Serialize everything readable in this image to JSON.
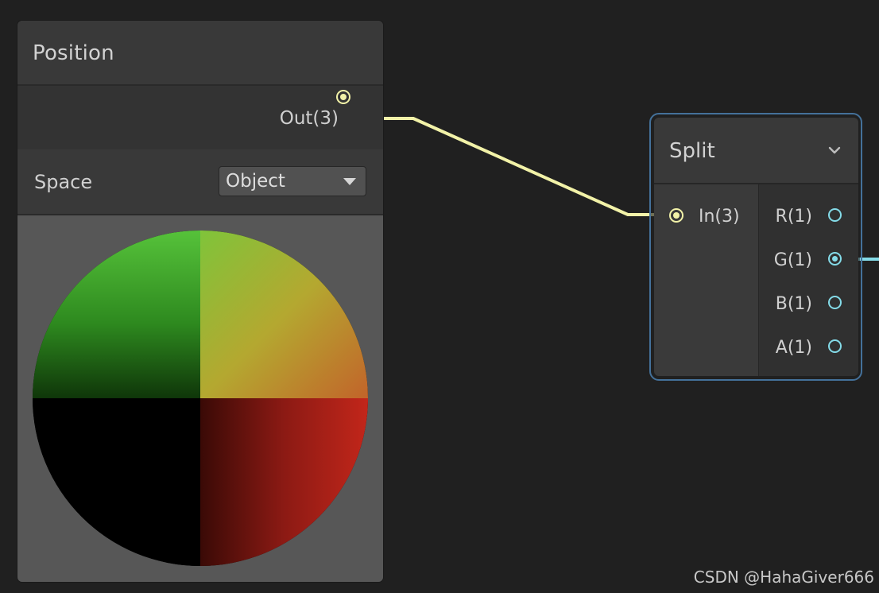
{
  "position_node": {
    "title": "Position",
    "output_label": "Out(3)",
    "space_label": "Space",
    "space_value": "Object"
  },
  "split_node": {
    "title": "Split",
    "input_label": "In(3)",
    "outputs": [
      {
        "label": "R(1)",
        "connected": false
      },
      {
        "label": "G(1)",
        "connected": true
      },
      {
        "label": "B(1)",
        "connected": false
      },
      {
        "label": "A(1)",
        "connected": false
      }
    ]
  },
  "colors": {
    "canvas": "#202020",
    "vector3_port": "#f2f2a8",
    "vector1_port": "#84dbe8",
    "selection_outline": "#44719a"
  },
  "icons": {
    "dropdown": "triangle-down",
    "collapse": "chevron-down"
  },
  "watermark": "CSDN @HahaGiver666"
}
